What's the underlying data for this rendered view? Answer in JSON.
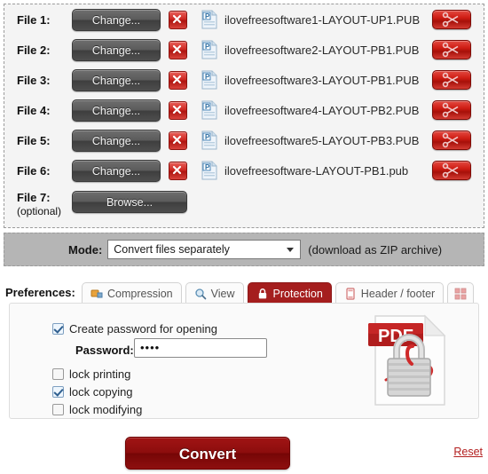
{
  "files_panel": {
    "rows": [
      {
        "label": "File 1:",
        "button": "Change...",
        "name": "ilovefreesoftware1-LAYOUT-UP1.PUB",
        "doc_icon": "publisher-file-icon",
        "delete_icon": "red-x-delete-icon",
        "cut_icon": "scissors-icon"
      },
      {
        "label": "File 2:",
        "button": "Change...",
        "name": "ilovefreesoftware2-LAYOUT-PB1.PUB",
        "doc_icon": "publisher-file-icon",
        "delete_icon": "red-x-delete-icon",
        "cut_icon": "scissors-icon"
      },
      {
        "label": "File 3:",
        "button": "Change...",
        "name": "ilovefreesoftware3-LAYOUT-PB1.PUB",
        "doc_icon": "publisher-file-icon",
        "delete_icon": "red-x-delete-icon",
        "cut_icon": "scissors-icon"
      },
      {
        "label": "File 4:",
        "button": "Change...",
        "name": "ilovefreesoftware4-LAYOUT-PB2.PUB",
        "doc_icon": "publisher-file-icon",
        "delete_icon": "red-x-delete-icon",
        "cut_icon": "scissors-icon"
      },
      {
        "label": "File 5:",
        "button": "Change...",
        "name": "ilovefreesoftware5-LAYOUT-PB3.PUB",
        "doc_icon": "publisher-file-icon",
        "delete_icon": "red-x-delete-icon",
        "cut_icon": "scissors-icon"
      },
      {
        "label": "File 6:",
        "button": "Change...",
        "name": "ilovefreesoftware-LAYOUT-PB1.pub",
        "doc_icon": "publisher-file-icon",
        "delete_icon": "red-x-delete-icon",
        "cut_icon": "scissors-icon"
      }
    ],
    "optional_row": {
      "label": "File 7:",
      "sub_label": "(optional)",
      "button": "Browse..."
    }
  },
  "mode_bar": {
    "label": "Mode:",
    "selected": "Convert files separately",
    "hint": "(download as ZIP archive)",
    "caret_icon": "chevron-down-icon"
  },
  "preferences": {
    "label": "Preferences:",
    "tabs": [
      {
        "label": "Compression",
        "icon": "compression-icon",
        "active": false
      },
      {
        "label": "View",
        "icon": "magnifier-icon",
        "active": false
      },
      {
        "label": "Protection",
        "icon": "padlock-icon",
        "active": true
      },
      {
        "label": "Header / footer",
        "icon": "page-icon",
        "active": false
      },
      {
        "label": "",
        "icon": "grid-squares-icon",
        "active": false
      }
    ]
  },
  "protection_panel": {
    "create_password": {
      "label": "Create password for opening",
      "checked": true
    },
    "password_field": {
      "label": "Password:",
      "value": "••••"
    },
    "options": [
      {
        "label": "lock printing",
        "checked": false
      },
      {
        "label": "lock copying",
        "checked": true
      },
      {
        "label": "lock modifying",
        "checked": false
      }
    ],
    "graphic": {
      "name": "pdf-lock-graphic",
      "badge": "PDF"
    }
  },
  "actions": {
    "convert": "Convert",
    "reset": "Reset"
  },
  "colors": {
    "accent_red": "#a51e1e",
    "convert_red": "#8c0d0d",
    "mode_bar_gray": "#b5b5b5",
    "panel_bg": "#f4f4f4"
  }
}
